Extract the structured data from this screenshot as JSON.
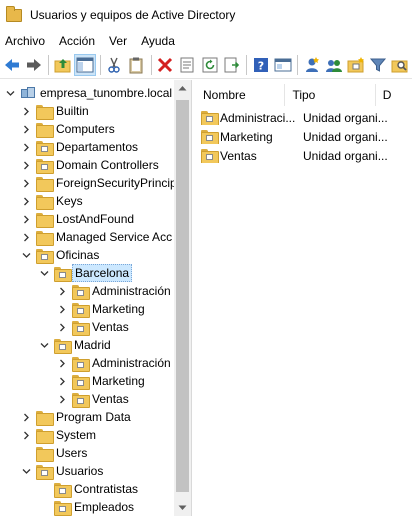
{
  "window": {
    "title": "Usuarios y equipos de Active Directory"
  },
  "menubar": {
    "items": [
      "Archivo",
      "Acción",
      "Ver",
      "Ayuda"
    ]
  },
  "toolbar": {
    "buttons": [
      "back-icon",
      "forward-icon",
      "up-folder-icon",
      "show-hide-tree-icon",
      "cut-icon",
      "clipboard-icon",
      "delete-icon",
      "properties-icon",
      "refresh-icon",
      "export-list-icon",
      "help-icon",
      "console-icon",
      "new-user-icon",
      "new-group-icon",
      "new-ou-icon",
      "filter-icon",
      "find-icon"
    ]
  },
  "tree": {
    "root": "empresa_tunombre.local",
    "items": [
      {
        "label": "Builtin"
      },
      {
        "label": "Computers"
      },
      {
        "label": "Departamentos"
      },
      {
        "label": "Domain Controllers"
      },
      {
        "label": "ForeignSecurityPrincip"
      },
      {
        "label": "Keys"
      },
      {
        "label": "LostAndFound"
      },
      {
        "label": "Managed Service Acc"
      },
      {
        "label": "Oficinas"
      },
      {
        "label": "Barcelona"
      },
      {
        "label": "Administración"
      },
      {
        "label": "Marketing"
      },
      {
        "label": "Ventas"
      },
      {
        "label": "Madrid"
      },
      {
        "label": "Administración"
      },
      {
        "label": "Marketing"
      },
      {
        "label": "Ventas"
      },
      {
        "label": "Program Data"
      },
      {
        "label": "System"
      },
      {
        "label": "Users"
      },
      {
        "label": "Usuarios"
      },
      {
        "label": "Contratistas"
      },
      {
        "label": "Empleados"
      }
    ]
  },
  "list": {
    "columns": [
      "Nombre",
      "Tipo",
      "D"
    ],
    "rows": [
      {
        "name": "Administraci...",
        "type": "Unidad organi..."
      },
      {
        "name": "Marketing",
        "type": "Unidad organi..."
      },
      {
        "name": "Ventas",
        "type": "Unidad organi..."
      }
    ]
  }
}
